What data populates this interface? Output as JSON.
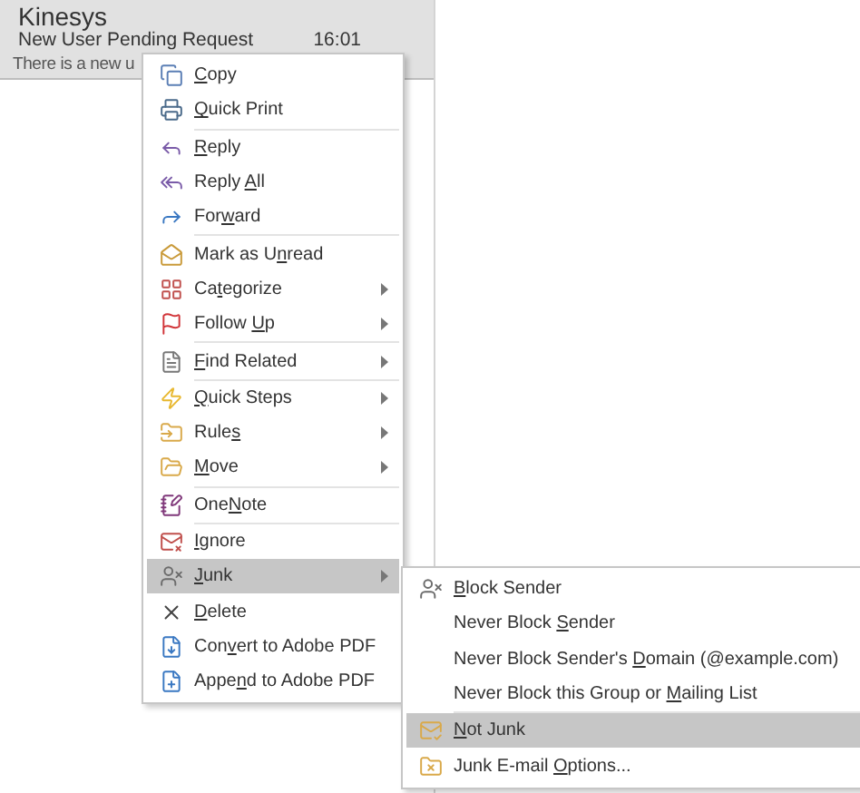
{
  "mail_item": {
    "sender": "Kinesys",
    "subject": "New User Pending Request",
    "time": "16:01",
    "preview": "There is a new u"
  },
  "context_menu": {
    "groups": [
      [
        {
          "label": {
            "key": "C",
            "post": "opy"
          },
          "submenu": false,
          "selected": false
        },
        {
          "label": {
            "key": "Q",
            "post": "uick Print"
          },
          "submenu": false,
          "selected": false
        }
      ],
      [
        {
          "label": {
            "key": "R",
            "post": "eply"
          },
          "submenu": false,
          "selected": false
        },
        {
          "label": {
            "pre": "Reply ",
            "key": "A",
            "post": "ll"
          },
          "submenu": false,
          "selected": false
        },
        {
          "label": {
            "pre": "For",
            "key": "w",
            "post": "ard"
          },
          "submenu": false,
          "selected": false
        }
      ],
      [
        {
          "label": {
            "pre": "Mark as U",
            "key": "n",
            "post": "read"
          },
          "submenu": false,
          "selected": false
        },
        {
          "label": {
            "pre": "Ca",
            "key": "t",
            "post": "egorize"
          },
          "submenu": true,
          "selected": false
        },
        {
          "label": {
            "pre": "Follow ",
            "key": "U",
            "post": "p"
          },
          "submenu": true,
          "selected": false
        }
      ],
      [
        {
          "label": {
            "key": "F",
            "post": "ind Related"
          },
          "submenu": true,
          "selected": false
        }
      ],
      [
        {
          "label": {
            "key": "Q",
            "post": "uick Steps"
          },
          "submenu": true,
          "selected": false
        },
        {
          "label": {
            "pre": "Rule",
            "key": "s"
          },
          "submenu": true,
          "selected": false
        },
        {
          "label": {
            "key": "M",
            "post": "ove"
          },
          "submenu": true,
          "selected": false
        }
      ],
      [
        {
          "label": {
            "pre": "One",
            "key": "N",
            "post": "ote"
          },
          "submenu": false,
          "selected": false
        }
      ],
      [
        {
          "label": {
            "key": "I",
            "post": "gnore"
          },
          "submenu": false,
          "selected": false
        },
        {
          "label": {
            "key": "J",
            "post": "unk"
          },
          "submenu": true,
          "selected": true
        },
        {
          "label": {
            "key": "D",
            "post": "elete"
          },
          "submenu": false,
          "selected": false
        },
        {
          "label": {
            "pre": "Con",
            "key": "v",
            "post": "ert to Adobe PDF"
          },
          "submenu": false,
          "selected": false
        },
        {
          "label": {
            "pre": "Appe",
            "key": "n",
            "post": "d to Adobe PDF"
          },
          "submenu": false,
          "selected": false
        }
      ]
    ]
  },
  "junk_submenu": {
    "groups": [
      [
        {
          "label": {
            "key": "B",
            "post": "lock Sender"
          },
          "selected": false
        },
        {
          "label": {
            "pre": "Never Block ",
            "key": "S",
            "post": "ender"
          },
          "selected": false
        },
        {
          "label": {
            "pre": "Never Block Sender's ",
            "key": "D",
            "post": "omain (@example.com)"
          },
          "selected": false
        },
        {
          "label": {
            "pre": "Never Block this Group or ",
            "key": "M",
            "post": "ailing List"
          },
          "selected": false
        }
      ],
      [
        {
          "label": {
            "key": "N",
            "post": "ot Junk"
          },
          "selected": true
        },
        {
          "label": {
            "pre": "Junk E-mail ",
            "key": "O",
            "post": "ptions..."
          },
          "selected": false
        }
      ]
    ]
  }
}
